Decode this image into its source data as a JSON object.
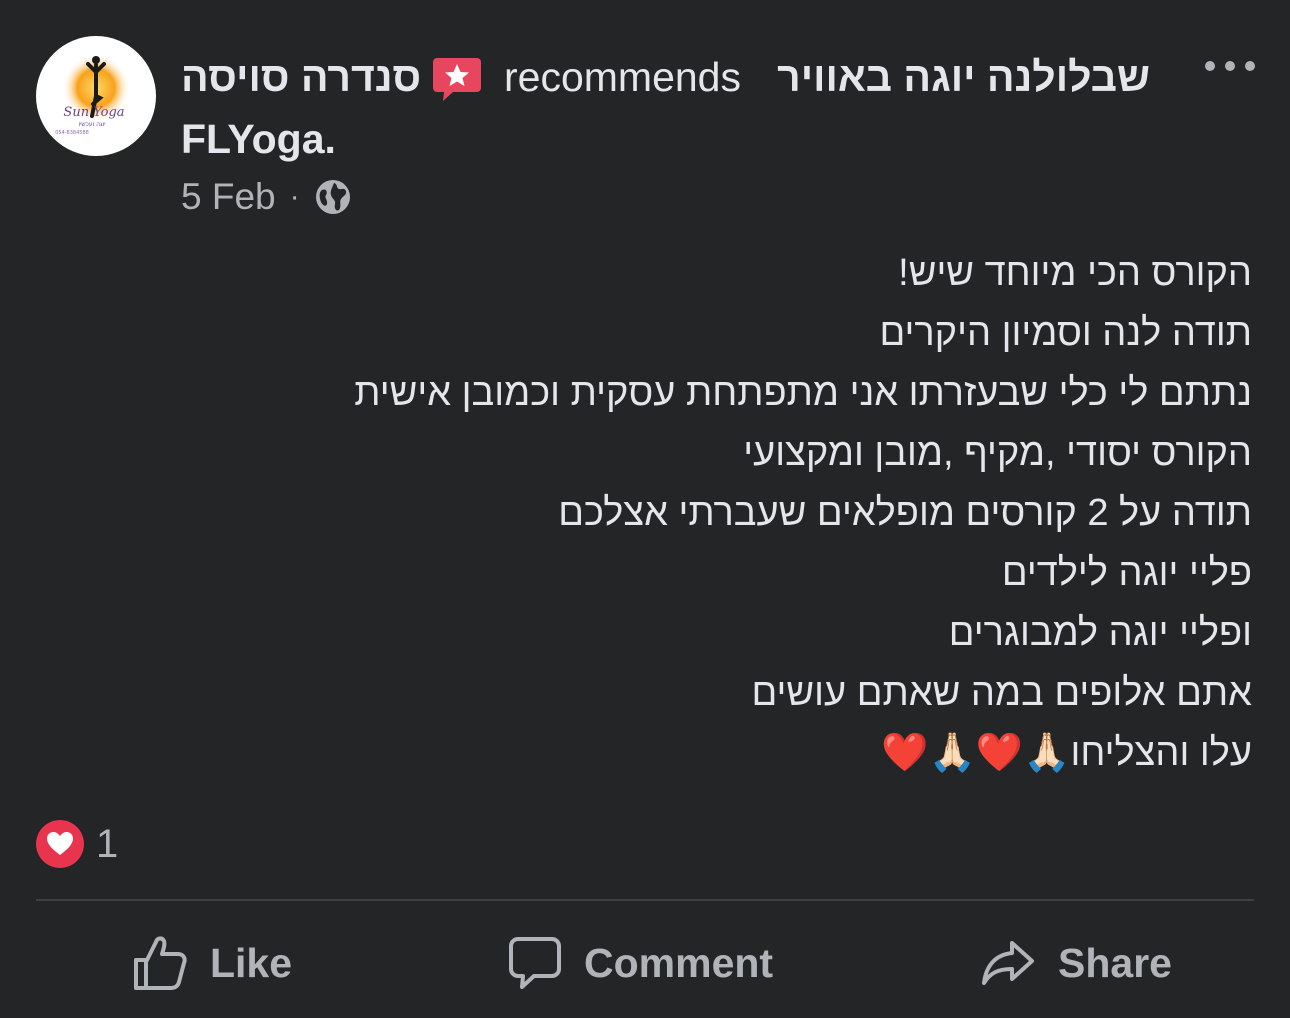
{
  "post": {
    "author": "סנדרה סויסה",
    "action_word": "recommends",
    "page_name_line1": "שבלולנה יוגה באוויר",
    "page_name_line2": "FLYoga.",
    "date": "5 Feb",
    "separator": "·",
    "avatar_text": {
      "brand": "Sun Yoga",
      "subtitle": "יוגה ועכשיו",
      "phone": "054-8384588"
    },
    "body_lines": [
      "הקורס הכי מיוחד שיש!",
      "תודה לנה וסמיון היקרים",
      "נתתם לי כלי שבעזרתו אני מתפתחת עסקית וכמובן אישית",
      "הקורס יסודי ,מקיף ,מובן ומקצועי",
      "תודה על 2 קורסים מופלאים שעברתי אצלכם",
      "פליי יוגה לילדים",
      "ופליי יוגה למבוגרים",
      "אתם אלופים במה שאתם עושים",
      "עלו והצליחו🙏🏻❤️🙏🏻❤️"
    ]
  },
  "reactions": {
    "icon": "love-reaction-icon",
    "count": "1"
  },
  "actions": {
    "like": "Like",
    "comment": "Comment",
    "share": "Share"
  },
  "colors": {
    "background": "#242526",
    "primary_text": "#e4e6eb",
    "secondary_text": "#b0b3b8",
    "love": "#e8344d",
    "recommend_badge": "#e8465f",
    "divider": "#3e4042"
  }
}
